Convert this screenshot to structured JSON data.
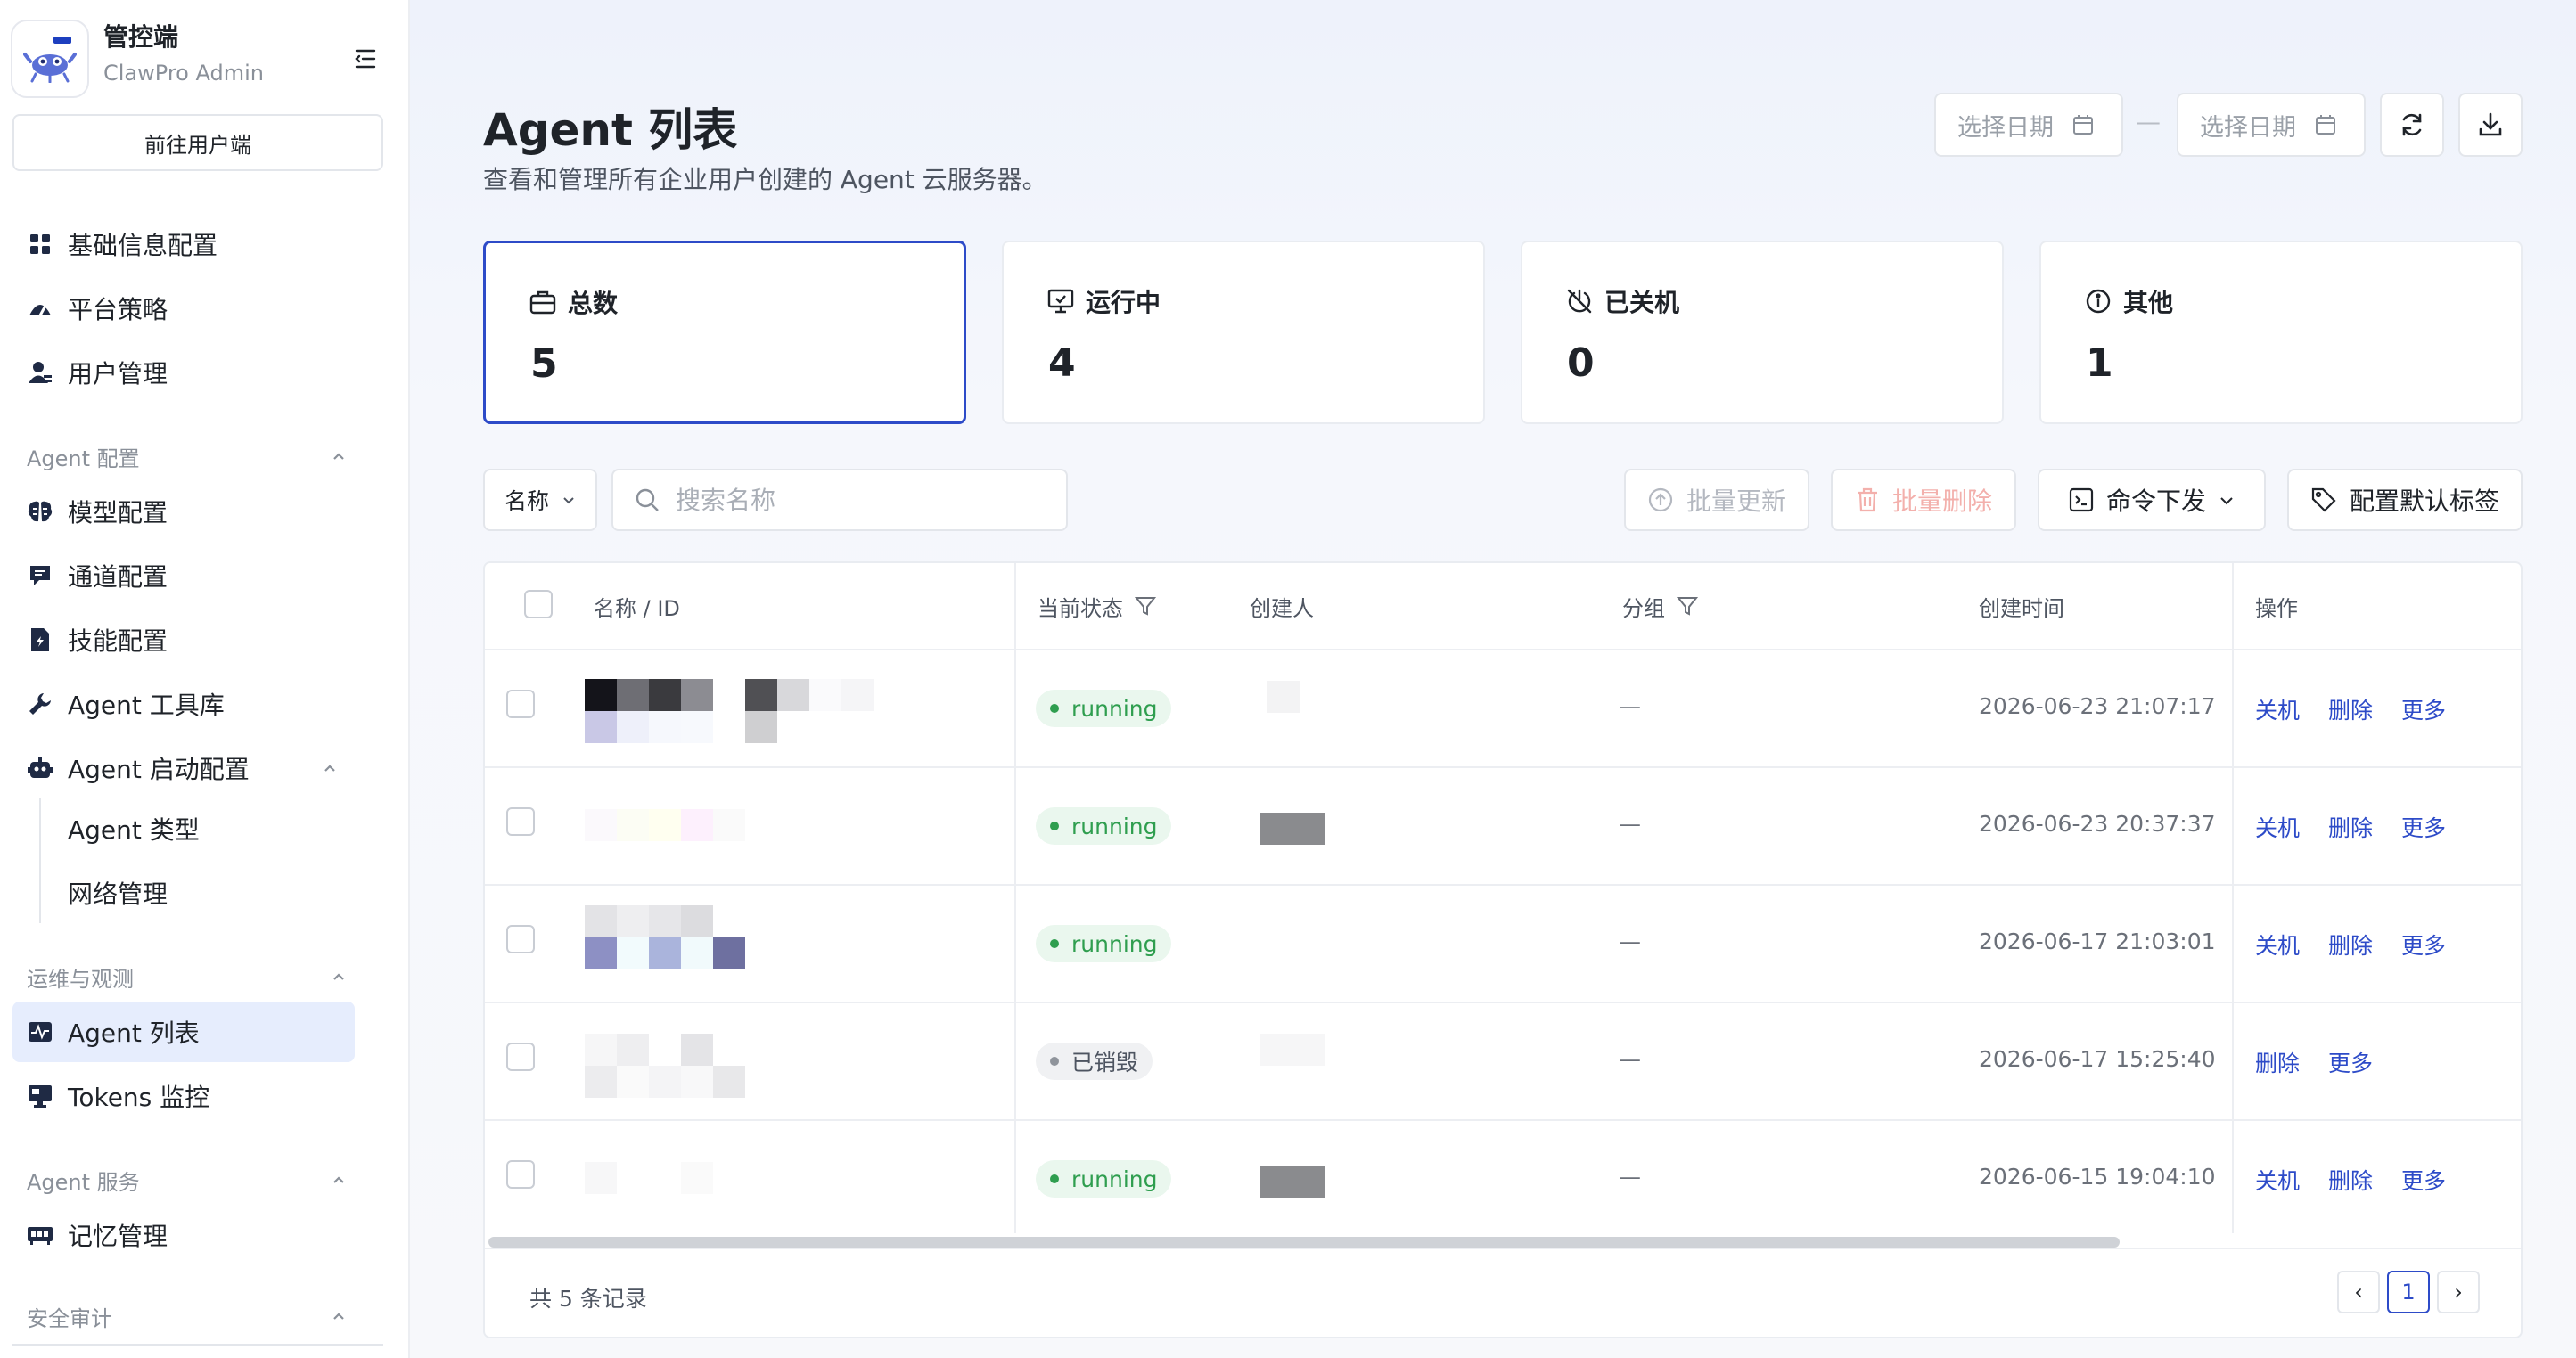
{
  "brand": {
    "title": "管控端",
    "subtitle": "ClawPro Admin"
  },
  "sidebar": {
    "goto_user": "前往用户端",
    "top_items": [
      {
        "label": "基础信息配置",
        "icon": "grid-icon"
      },
      {
        "label": "平台策略",
        "icon": "strategy-icon"
      },
      {
        "label": "用户管理",
        "icon": "user-icon"
      }
    ],
    "groups": [
      {
        "label": "Agent 配置",
        "items": [
          {
            "label": "模型配置",
            "icon": "brain-icon"
          },
          {
            "label": "通道配置",
            "icon": "chat-icon"
          },
          {
            "label": "技能配置",
            "icon": "skill-icon"
          },
          {
            "label": "Agent 工具库",
            "icon": "wrench-icon"
          },
          {
            "label": "Agent 启动配置",
            "icon": "robot-icon"
          }
        ],
        "sub_items": [
          "Agent 类型",
          "网络管理"
        ]
      },
      {
        "label": "运维与观测",
        "items": [
          {
            "label": "Agent 列表",
            "icon": "activity-icon"
          },
          {
            "label": "Tokens 监控",
            "icon": "monitor-icon"
          }
        ]
      },
      {
        "label": "Agent 服务",
        "items": [
          {
            "label": "记忆管理",
            "icon": "memory-icon"
          }
        ]
      },
      {
        "label": "安全审计",
        "items": []
      }
    ]
  },
  "header": {
    "title": "Agent 列表",
    "description": "查看和管理所有企业用户创建的 Agent 云服务器。",
    "date_start_placeholder": "选择日期",
    "date_end_placeholder": "选择日期",
    "date_separator": "—"
  },
  "stats": [
    {
      "label": "总数",
      "value": "5",
      "icon": "briefcase-icon"
    },
    {
      "label": "运行中",
      "value": "4",
      "icon": "screen-check-icon"
    },
    {
      "label": "已关机",
      "value": "0",
      "icon": "power-off-icon"
    },
    {
      "label": "其他",
      "value": "1",
      "icon": "info-icon"
    }
  ],
  "toolbar": {
    "filter_field": "名称",
    "search_placeholder": "搜索名称",
    "batch_update": "批量更新",
    "batch_delete": "批量删除",
    "command": "命令下发",
    "default_tags": "配置默认标签"
  },
  "table": {
    "columns": {
      "name": "名称 / ID",
      "status": "当前状态",
      "creator": "创建人",
      "group": "分组",
      "created": "创建时间",
      "ops": "操作"
    },
    "rows": [
      {
        "status": "running",
        "status_kind": "run",
        "group": "—",
        "created": "2026-06-23 21:07:17",
        "ops": [
          "关机",
          "删除",
          "更多"
        ]
      },
      {
        "status": "running",
        "status_kind": "run",
        "group": "—",
        "created": "2026-06-23 20:37:37",
        "ops": [
          "关机",
          "删除",
          "更多"
        ]
      },
      {
        "status": "running",
        "status_kind": "run",
        "group": "—",
        "created": "2026-06-17 21:03:01",
        "ops": [
          "关机",
          "删除",
          "更多"
        ]
      },
      {
        "status": "已销毁",
        "status_kind": "des",
        "group": "—",
        "created": "2026-06-17 15:25:40",
        "ops": [
          "删除",
          "更多"
        ]
      },
      {
        "status": "running",
        "status_kind": "run",
        "group": "—",
        "created": "2026-06-15 19:04:10",
        "ops": [
          "关机",
          "删除",
          "更多"
        ]
      }
    ],
    "footer_total": "共 5 条记录",
    "current_page": "1",
    "prev": "‹",
    "next": "›"
  },
  "colors": {
    "accent": "#2d4bc8",
    "running": "#2f9e4f",
    "destroyed": "#8f949b",
    "danger_disabled": "#f3b0ac"
  }
}
